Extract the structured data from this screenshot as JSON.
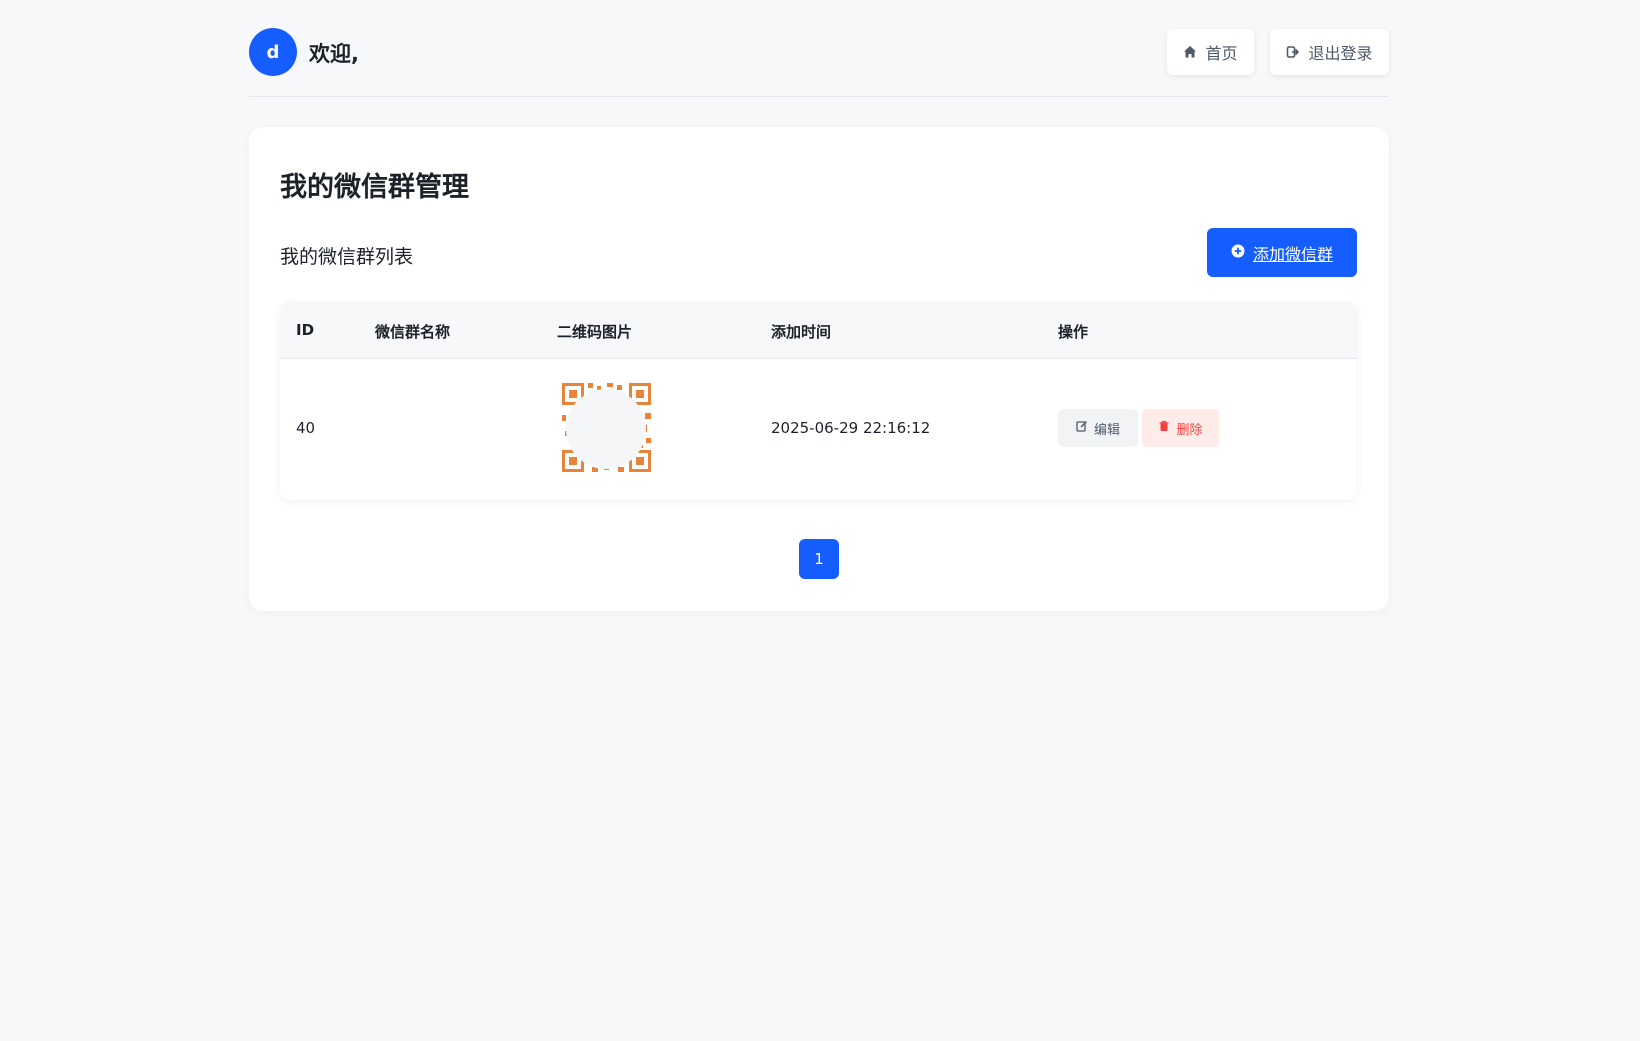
{
  "header": {
    "avatar_letter": "d",
    "welcome_text": "欢迎,",
    "home_label": "首页",
    "logout_label": "退出登录"
  },
  "card": {
    "title": "我的微信群管理",
    "list_title": "我的微信群列表",
    "add_button_label": "添加微信群"
  },
  "table": {
    "columns": [
      "ID",
      "微信群名称",
      "二维码图片",
      "添加时间",
      "操作"
    ],
    "rows": [
      {
        "id": "40",
        "name": "",
        "created_at": "2025-06-29 22:16:12",
        "edit_label": "编辑",
        "delete_label": "删除"
      }
    ]
  },
  "pagination": {
    "current_page": "1"
  },
  "colors": {
    "primary": "#165dff",
    "danger": "#f53f3f",
    "qr_orange": "#e8843a"
  },
  "icons": {
    "home": "home-icon",
    "logout": "sign-out-icon",
    "add": "plus-circle-icon",
    "edit": "edit-icon",
    "delete": "trash-icon"
  }
}
